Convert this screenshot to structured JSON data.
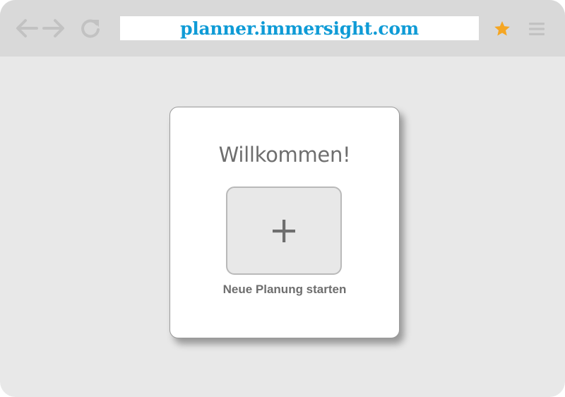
{
  "browser": {
    "url": "planner.immersight.com",
    "icons": {
      "back": "arrow-left-icon",
      "forward": "arrow-right-icon",
      "reload": "reload-icon",
      "bookmark": "star-icon",
      "menu": "hamburger-menu-icon"
    },
    "colors": {
      "url_text": "#0f9bd6",
      "star": "#f5a623",
      "toolbar": "#d9d9d9",
      "icon_gray": "#c2c2c2"
    }
  },
  "welcome_card": {
    "title": "Willkommen!",
    "new_plan_icon": "plus-icon",
    "new_plan_label": "Neue Planung starten"
  }
}
